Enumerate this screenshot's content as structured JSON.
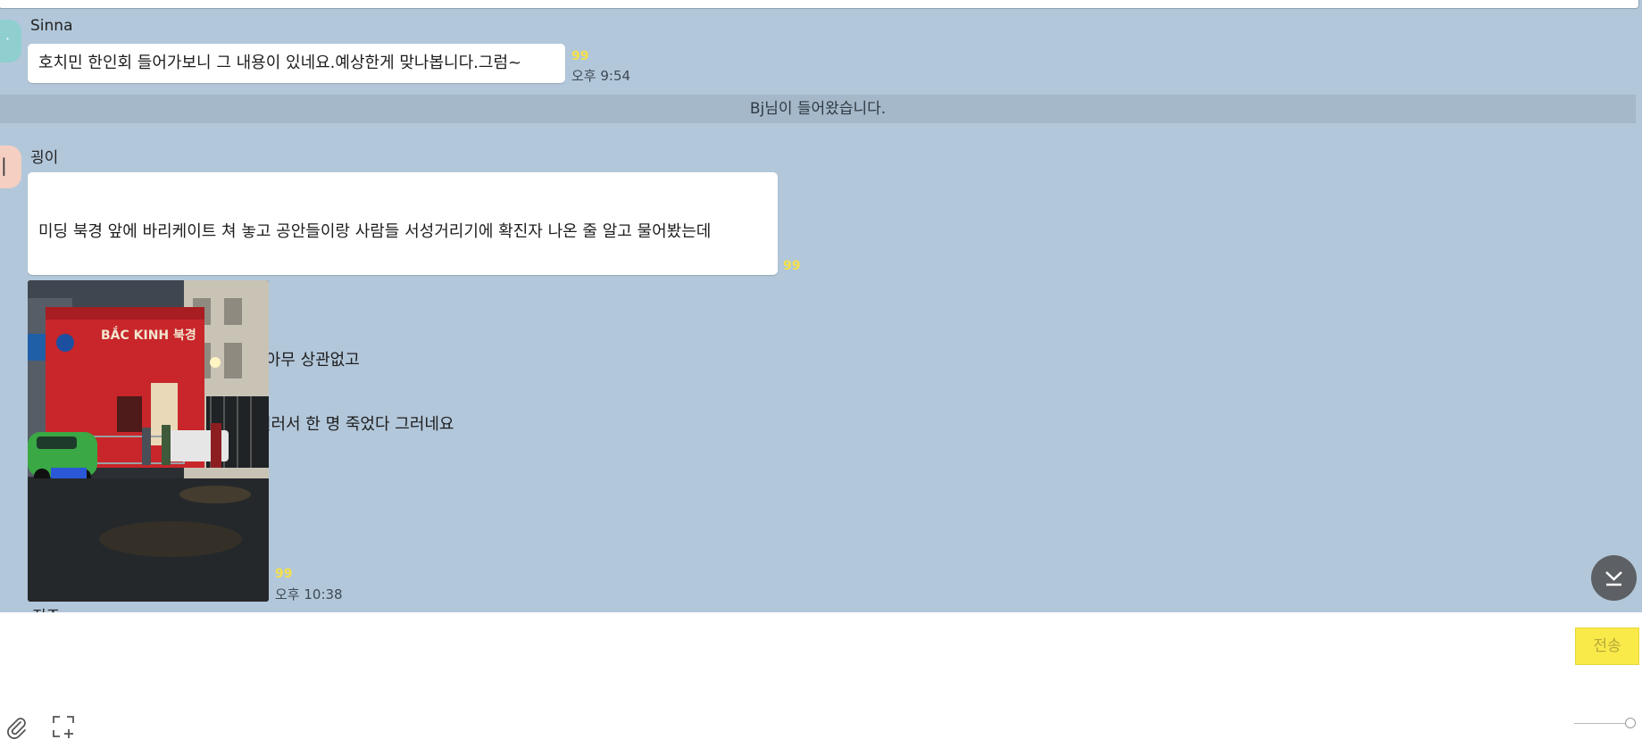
{
  "chat": {
    "messages": [
      {
        "sender": "Sinna",
        "text": "호치민 한인회 들어가보니 그 내용이 있네요.예상한게 맞나봅니다.그럼~",
        "unread": "99",
        "time": "오후 9:54",
        "avatar_color": "#8fcfd0"
      },
      {
        "sender": "굉이",
        "lines": [
          "미딩 북경 앞에 바리케이트 쳐 놓고 공안들이랑 사람들 서성거리기에 확진자 나온 줄 알고 물어봤는데",
          "",
          "경비 아저씨에게 물어보니 식당과 아무 상관없고",
          "길에서 두 사람이 싸웠는데 칼로 찔러서 한 명 죽었다 그러네요"
        ],
        "unread": "99",
        "avatar_color": "#f4cfc2"
      },
      {
        "type": "photo",
        "image_description_text": "BẮC KINH 북경",
        "unread": "99",
        "time": "오후 10:38"
      }
    ],
    "system_notice": "Bj님이 들어왔습니다.",
    "partial_next_sender": "진주"
  },
  "input": {
    "placeholder": "",
    "value": "",
    "send_label": "전송"
  },
  "toolbar": {
    "icons": [
      "paperclip-icon",
      "capture-icon"
    ]
  },
  "colors": {
    "chat_background": "#b2c7da",
    "bubble": "#ffffff",
    "send_button": "#f9e949",
    "unread_count": "#f5e04b",
    "notice_bar": "#a5b8c9"
  }
}
